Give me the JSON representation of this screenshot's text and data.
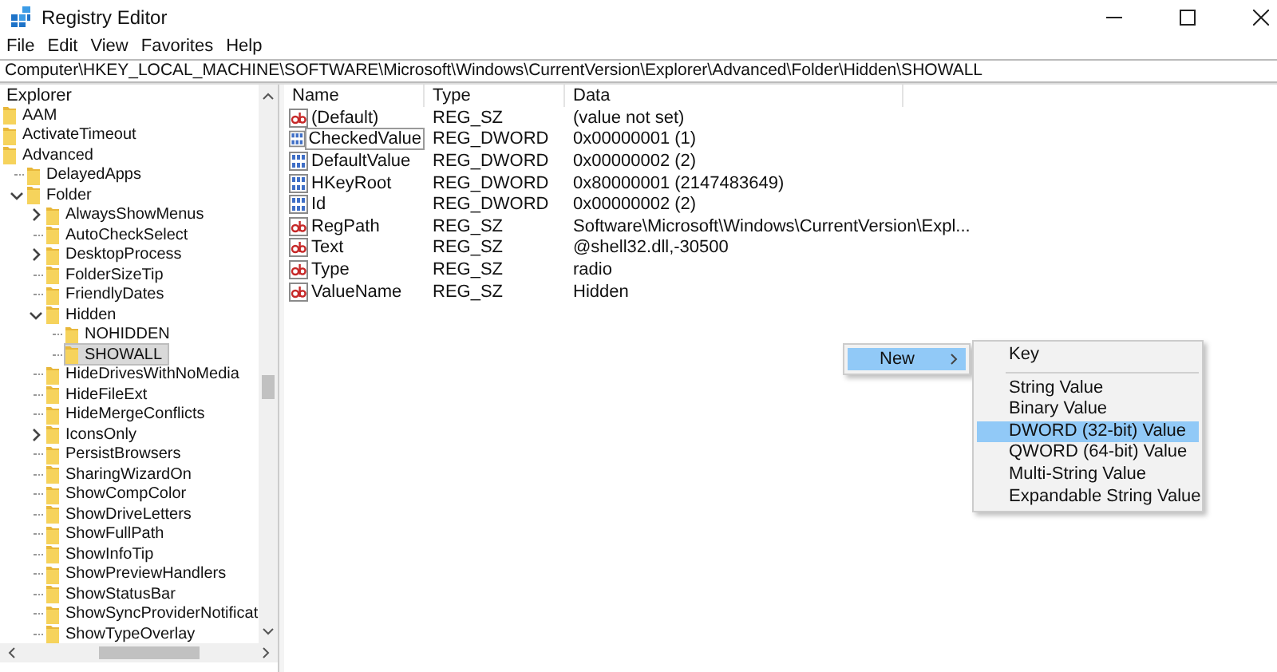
{
  "window": {
    "title": "Registry Editor"
  },
  "menu_bar": [
    "File",
    "Edit",
    "View",
    "Favorites",
    "Help"
  ],
  "address": "Computer\\HKEY_LOCAL_MACHINE\\SOFTWARE\\Microsoft\\Windows\\CurrentVersion\\Explorer\\Advanced\\Folder\\Hidden\\SHOWALL",
  "tree": {
    "header": "Explorer",
    "items": [
      {
        "label": "AAM",
        "selected": false
      },
      {
        "label": "ActivateTimeout",
        "selected": false
      },
      {
        "label": "Advanced",
        "selected": false,
        "children": [
          {
            "label": "DelayedApps",
            "selected": false
          },
          {
            "label": "Folder",
            "expanded": true,
            "selected": false,
            "children": [
              {
                "label": "AlwaysShowMenus",
                "expanded": false,
                "selected": false
              },
              {
                "label": "AutoCheckSelect",
                "selected": false
              },
              {
                "label": "DesktopProcess",
                "expanded": false,
                "selected": false
              },
              {
                "label": "FolderSizeTip",
                "selected": false
              },
              {
                "label": "FriendlyDates",
                "selected": false
              },
              {
                "label": "Hidden",
                "expanded": true,
                "selected": false,
                "children": [
                  {
                    "label": "NOHIDDEN",
                    "selected": false
                  },
                  {
                    "label": "SHOWALL",
                    "selected": true
                  }
                ]
              },
              {
                "label": "HideDrivesWithNoMedia",
                "selected": false
              },
              {
                "label": "HideFileExt",
                "selected": false
              },
              {
                "label": "HideMergeConflicts",
                "selected": false
              },
              {
                "label": "IconsOnly",
                "expanded": false,
                "selected": false
              },
              {
                "label": "PersistBrowsers",
                "selected": false
              },
              {
                "label": "SharingWizardOn",
                "selected": false
              },
              {
                "label": "ShowCompColor",
                "selected": false
              },
              {
                "label": "ShowDriveLetters",
                "selected": false
              },
              {
                "label": "ShowFullPath",
                "selected": false
              },
              {
                "label": "ShowInfoTip",
                "selected": false
              },
              {
                "label": "ShowPreviewHandlers",
                "selected": false
              },
              {
                "label": "ShowStatusBar",
                "selected": false
              },
              {
                "label": "ShowSyncProviderNotificat",
                "selected": false
              },
              {
                "label": "ShowTypeOverlay",
                "selected": false
              }
            ]
          }
        ]
      }
    ]
  },
  "values": {
    "columns": [
      "Name",
      "Type",
      "Data"
    ],
    "rows": [
      {
        "kind": "string",
        "name": "(Default)",
        "type": "REG_SZ",
        "data": "(value not set)",
        "focused": false
      },
      {
        "kind": "dword",
        "name": "CheckedValue",
        "type": "REG_DWORD",
        "data": "0x00000001 (1)",
        "focused": true
      },
      {
        "kind": "dword",
        "name": "DefaultValue",
        "type": "REG_DWORD",
        "data": "0x00000002 (2)",
        "focused": false
      },
      {
        "kind": "dword",
        "name": "HKeyRoot",
        "type": "REG_DWORD",
        "data": "0x80000001 (2147483649)",
        "focused": false
      },
      {
        "kind": "dword",
        "name": "Id",
        "type": "REG_DWORD",
        "data": "0x00000002 (2)",
        "focused": false
      },
      {
        "kind": "string",
        "name": "RegPath",
        "type": "REG_SZ",
        "data": "Software\\Microsoft\\Windows\\CurrentVersion\\Expl...",
        "focused": false
      },
      {
        "kind": "string",
        "name": "Text",
        "type": "REG_SZ",
        "data": "@shell32.dll,-30500",
        "focused": false
      },
      {
        "kind": "string",
        "name": "Type",
        "type": "REG_SZ",
        "data": "radio",
        "focused": false
      },
      {
        "kind": "string",
        "name": "ValueName",
        "type": "REG_SZ",
        "data": "Hidden",
        "focused": false
      }
    ]
  },
  "context_menu": {
    "items": [
      {
        "label": "New",
        "selected": true
      }
    ]
  },
  "submenu": {
    "items": [
      {
        "kind": "item",
        "label": "Key",
        "selected": false
      },
      {
        "kind": "separator"
      },
      {
        "kind": "item",
        "label": "String Value",
        "selected": false
      },
      {
        "kind": "item",
        "label": "Binary Value",
        "selected": false
      },
      {
        "kind": "item",
        "label": "DWORD (32-bit) Value",
        "selected": true
      },
      {
        "kind": "item",
        "label": "QWORD (64-bit) Value",
        "selected": false
      },
      {
        "kind": "item",
        "label": "Multi-String Value",
        "selected": false
      },
      {
        "kind": "item",
        "label": "Expandable String Value",
        "selected": false
      }
    ]
  }
}
